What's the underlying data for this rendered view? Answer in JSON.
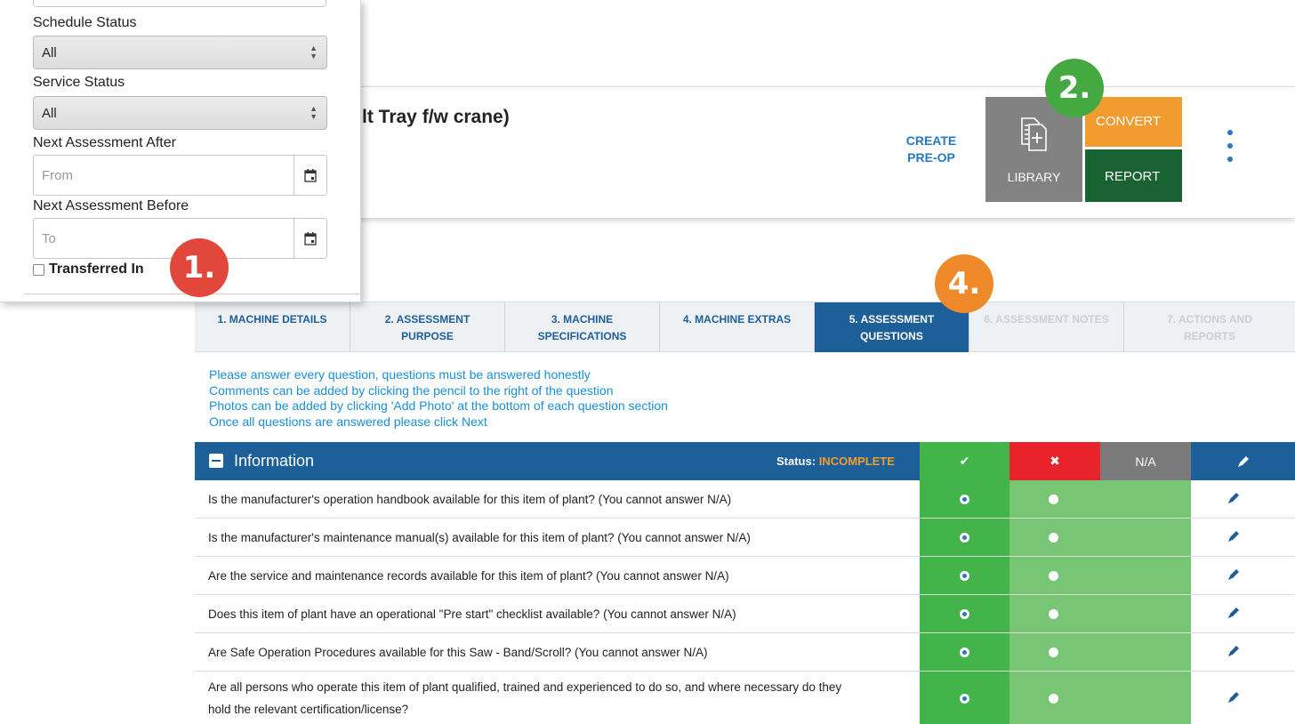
{
  "filters": {
    "schedule_status_label": "Schedule Status",
    "schedule_status_value": "All",
    "service_status_label": "Service Status",
    "service_status_value": "All",
    "next_after_label": "Next Assessment After",
    "next_after_placeholder": "From",
    "next_before_label": "Next Assessment Before",
    "next_before_placeholder": "To",
    "transferred_in_label": "Transferred In",
    "transferred_in_checked": false
  },
  "callouts": {
    "one": "1.",
    "two": "2.",
    "four": "4."
  },
  "header": {
    "machine_title": "lt Tray f/w crane)",
    "create_preop_line1": "CREATE",
    "create_preop_line2": "PRE-OP",
    "library_label": "LIBRARY",
    "library_icon": "document-add-icon",
    "convert_label": "CONVERT",
    "report_label": "REPORT",
    "more_icon": "vertical-dots-icon"
  },
  "tabs": [
    {
      "line1": "1. MACHINE DETAILS",
      "line2": "",
      "state": "normal"
    },
    {
      "line1": "2. ASSESSMENT",
      "line2": "PURPOSE",
      "state": "normal"
    },
    {
      "line1": "3. MACHINE",
      "line2": "SPECIFICATIONS",
      "state": "normal"
    },
    {
      "line1": "4. MACHINE EXTRAS",
      "line2": "",
      "state": "normal"
    },
    {
      "line1": "5. ASSESSMENT",
      "line2": "QUESTIONS",
      "state": "active"
    },
    {
      "line1": "6. ASSESSMENT NOTES",
      "line2": "",
      "state": "disabled"
    },
    {
      "line1": "7. ACTIONS AND",
      "line2": "REPORTS",
      "state": "disabled"
    }
  ],
  "instructions": [
    "Please answer every question, questions must be answered honestly",
    "Comments can be added by clicking the pencil to the right of the question",
    "Photos can be added by clicking 'Add Photo' at the bottom of each question section",
    "Once all questions are answered please click Next"
  ],
  "section": {
    "title": "Information",
    "status_label": "Status:",
    "status_value": "INCOMPLETE",
    "col_yes_icon": "check-icon",
    "col_yes": "✔",
    "col_no_icon": "cross-icon",
    "col_no": "✖",
    "col_na": "N/A",
    "col_edit_icon": "pencil-icon",
    "colors": {
      "header": "#1d5f98",
      "yes": "#43b44a",
      "no": "#e8232b",
      "na": "#7a7a7a",
      "status": "#f29c30"
    }
  },
  "questions": [
    {
      "text": "Is the manufacturer's operation handbook available for this item of plant? (You cannot answer N/A)",
      "answer": "yes"
    },
    {
      "text": "Is the manufacturer's maintenance manual(s) available for this item of plant? (You cannot answer N/A)",
      "answer": "yes"
    },
    {
      "text": "Are the service and maintenance records available for this item of plant? (You cannot answer N/A)",
      "answer": "yes"
    },
    {
      "text": "Does this item of plant have an operational \"Pre start\" checklist available? (You cannot answer N/A)",
      "answer": "yes"
    },
    {
      "text": "Are Safe Operation Procedures available for this Saw - Band/Scroll? (You cannot answer N/A)",
      "answer": "yes"
    },
    {
      "text": "Are all persons who operate this item of plant qualified, trained and experienced to do so, and where necessary do they",
      "text2": "hold the relevant certification/license?",
      "answer": "yes"
    }
  ]
}
